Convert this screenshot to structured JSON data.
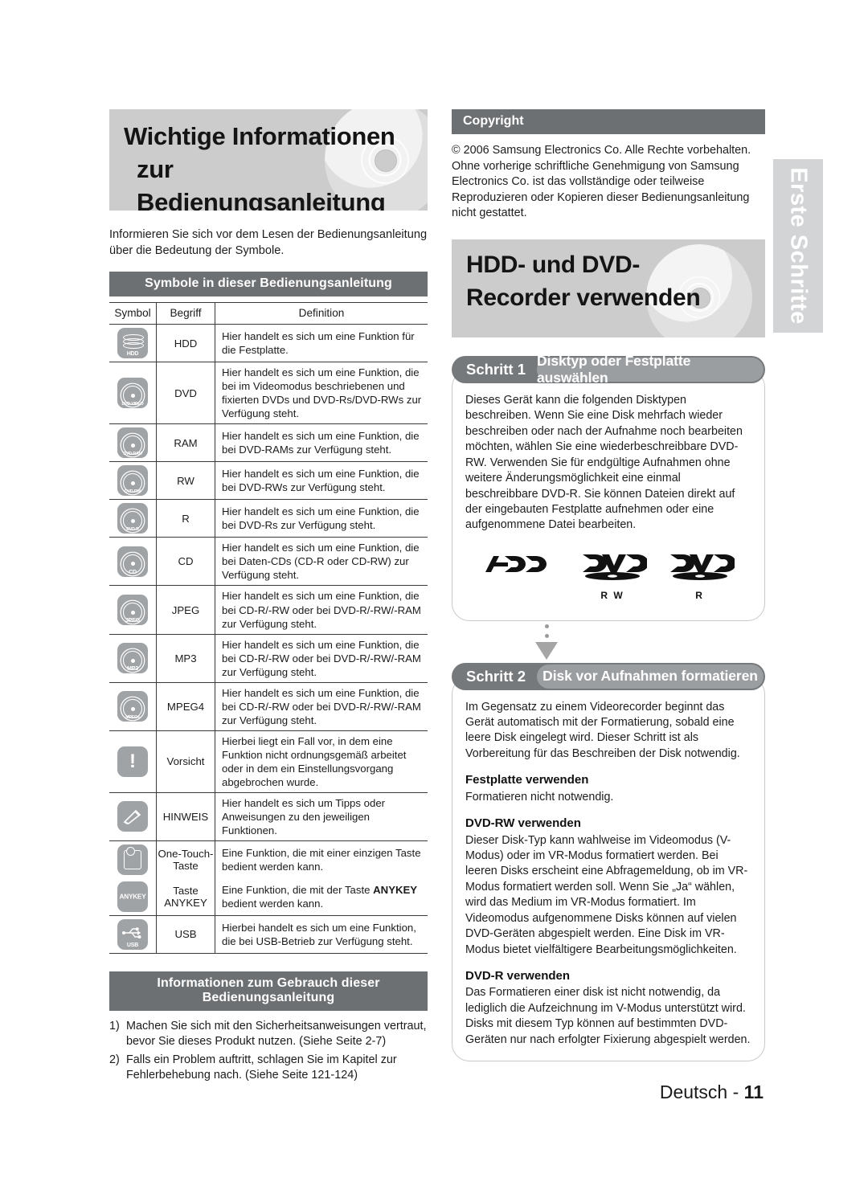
{
  "side_tab": {
    "label": "Erste Schritte"
  },
  "left": {
    "hero": {
      "line1": "Wichtige Informationen",
      "line2": "zur Bedienungsanleitung"
    },
    "intro": "Informieren Sie sich vor dem Lesen der Bedienungsanleitung über die Bedeutung der Symbole.",
    "symbols_bar": "Symbole in dieser Bedienungsanleitung",
    "table": {
      "headers": {
        "symbol": "Symbol",
        "term": "Begriff",
        "definition": "Definition"
      },
      "rows": [
        {
          "icon": "hdd-icon",
          "icon_caption": "HDD",
          "term": "HDD",
          "definition": "Hier handelt es sich um eine Funktion für die Festplatte."
        },
        {
          "icon": "dvd-video-icon",
          "icon_caption": "DVD-VIDEO",
          "term": "DVD",
          "definition": "Hier handelt es sich um eine Funktion, die bei im Videomodus beschriebenen und fixierten DVDs und DVD-Rs/DVD-RWs zur Verfügung steht."
        },
        {
          "icon": "dvd-ram-icon",
          "icon_caption": "DVD-RAM",
          "term": "RAM",
          "definition": "Hier handelt es sich um eine Funktion, die bei DVD-RAMs zur Verfügung steht."
        },
        {
          "icon": "dvd-rw-icon",
          "icon_caption": "DVD-RW",
          "term": "RW",
          "definition": "Hier handelt es sich um eine Funktion, die bei DVD-RWs zur Verfügung steht."
        },
        {
          "icon": "dvd-r-icon",
          "icon_caption": "DVD-R",
          "term": "R",
          "definition": "Hier handelt es sich um eine Funktion, die bei DVD-Rs zur Verfügung steht."
        },
        {
          "icon": "cd-icon",
          "icon_caption": "CD",
          "term": "CD",
          "definition": "Hier handelt es sich um eine Funktion, die bei Daten-CDs (CD-R oder CD-RW) zur Verfügung steht."
        },
        {
          "icon": "jpeg-icon",
          "icon_caption": "JPEG",
          "term": "JPEG",
          "definition": "Hier handelt es sich um eine Funktion, die bei CD-R/-RW oder bei DVD-R/-RW/-RAM zur Verfügung steht."
        },
        {
          "icon": "mp3-icon",
          "icon_caption": "MP3",
          "term": "MP3",
          "definition": "Hier handelt es sich um eine Funktion, die bei CD-R/-RW oder bei DVD-R/-RW/-RAM zur Verfügung steht."
        },
        {
          "icon": "mpeg4-icon",
          "icon_caption": "MPEG4",
          "term": "MPEG4",
          "definition": "Hier handelt es sich um eine Funktion, die bei CD-R/-RW oder bei DVD-R/-RW/-RAM zur Verfügung steht."
        },
        {
          "icon": "caution-icon",
          "icon_caption": "",
          "term": "Vorsicht",
          "definition": "Hierbei liegt ein Fall vor, in dem eine Funktion nicht ordnungsgemäß arbeitet oder in dem ein Einstellungsvorgang abgebrochen wurde."
        },
        {
          "icon": "pencil-note-icon",
          "icon_caption": "",
          "term": "HINWEIS",
          "definition": "Hier handelt es sich um Tipps oder Anweisungen zu den jeweiligen Funktionen."
        },
        {
          "icon": "one-touch-icon",
          "icon_caption": "",
          "term": "One-Touch-Taste",
          "definition": "Eine Funktion, die mit einer einzigen Taste bedient werden kann."
        },
        {
          "icon": "anykey-icon",
          "icon_caption": "ANYKEY",
          "term": "Taste ANYKEY",
          "definition_pre": "Eine Funktion, die mit der Taste ",
          "definition_strong": "ANYKEY",
          "definition_post": " bedient werden kann."
        },
        {
          "icon": "usb-icon",
          "icon_caption": "USB",
          "term": "USB",
          "definition": "Hierbei handelt es sich um eine Funktion, die bei USB-Betrieb zur Verfügung steht."
        }
      ]
    },
    "usage_bar": "Informationen zum Gebrauch dieser Bedienungsanleitung",
    "notes": [
      {
        "num": "1)",
        "text": "Machen Sie sich mit den Sicherheitsanweisungen vertraut, bevor Sie dieses Produkt nutzen. (Siehe Seite 2-7)"
      },
      {
        "num": "2)",
        "text": "Falls ein Problem auftritt, schlagen Sie im Kapitel zur Fehlerbehebung nach. (Siehe Seite 121-124)"
      }
    ]
  },
  "right": {
    "copyright_bar": "Copyright",
    "copyright_text": "© 2006 Samsung Electronics Co. Alle Rechte vorbehalten. Ohne vorherige schriftliche Genehmigung von Samsung Electronics Co. ist das vollständige oder teilweise Reproduzieren oder Kopieren dieser Bedienungsanleitung nicht gestattet.",
    "hero": {
      "line1": "HDD- und DVD-",
      "line2": "Recorder verwenden"
    },
    "step1": {
      "number": "Schritt 1",
      "title": "Disktyp oder Festplatte auswählen",
      "body": "Dieses Gerät kann die folgenden Disktypen beschreiben. Wenn Sie eine Disk mehrfach wieder beschreiben oder nach der Aufnahme noch bearbeiten möchten, wählen Sie eine wiederbeschreibbare DVD-RW. Verwenden Sie für endgültige Aufnahmen ohne weitere Änderungsmöglichkeit eine einmal beschreibbare DVD-R. Sie können Dateien direkt auf der eingebauten Festplatte aufnehmen oder eine aufgenommene Datei bearbeiten.",
      "logos": [
        {
          "name": "hdd-logo",
          "text": "HDD",
          "sub": ""
        },
        {
          "name": "dvd-rw-logo",
          "text": "DVD",
          "sub": "R W"
        },
        {
          "name": "dvd-r-logo",
          "text": "DVD",
          "sub": "R"
        }
      ]
    },
    "step2": {
      "number": "Schritt 2",
      "title": "Disk vor Aufnahmen formatieren",
      "body": "Im Gegensatz zu einem Videorecorder beginnt das Gerät automatisch mit der Formatierung, sobald eine leere Disk eingelegt wird. Dieser Schritt ist als Vorbereitung für das Beschreiben der Disk notwendig.",
      "sections": [
        {
          "heading": "Festplatte verwenden",
          "text": "Formatieren nicht notwendig."
        },
        {
          "heading": "DVD-RW verwenden",
          "text": "Dieser Disk-Typ kann wahlweise im Videomodus (V-Modus) oder im VR-Modus formatiert werden. Bei leeren Disks erscheint eine Abfragemeldung, ob im VR-Modus formatiert werden soll. Wenn Sie „Ja“ wählen, wird das Medium im VR-Modus formatiert. Im Videomodus aufgenommene Disks können auf vielen DVD-Geräten abgespielt werden. Eine Disk im VR-Modus bietet vielfältigere Bearbeitungsmöglichkeiten."
        },
        {
          "heading": "DVD-R verwenden",
          "text": "Das Formatieren einer disk ist nicht notwendig, da lediglich die Aufzeichnung im V-Modus unterstützt wird. Disks mit diesem Typ können auf bestimmten DVD-Geräten nur nach erfolgter Fixierung abgespielt werden."
        }
      ]
    }
  },
  "footer": {
    "language": "Deutsch - ",
    "page": "11"
  },
  "colors": {
    "bar": "#6d7073",
    "hero_bg": "#cccccc",
    "chip": "#a0a3a6",
    "step_head": "#76797c",
    "step_pill": "#9b9ea1",
    "side_tab": "#d2d4d6"
  }
}
